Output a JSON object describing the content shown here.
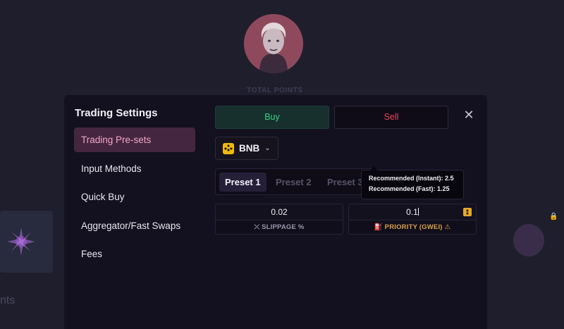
{
  "background": {
    "points_label": "TOTAL POINTS",
    "left_text": "nts"
  },
  "modal": {
    "title": "Trading Settings",
    "nav": [
      {
        "label": "Trading Pre-sets",
        "active": true
      },
      {
        "label": "Input Methods",
        "active": false
      },
      {
        "label": "Quick Buy",
        "active": false
      },
      {
        "label": "Aggregator/Fast Swaps",
        "active": false
      },
      {
        "label": "Fees",
        "active": false
      }
    ],
    "tabs": {
      "buy": "Buy",
      "sell": "Sell"
    },
    "chain": {
      "label": "BNB",
      "icon": "bnb-icon"
    },
    "presets": [
      {
        "label": "Preset 1",
        "active": true
      },
      {
        "label": "Preset 2",
        "active": false
      },
      {
        "label": "Preset 3",
        "active": false
      }
    ],
    "tooltip": {
      "line1": "Recommended (Instant): 2.5",
      "line2": "Recommended (Fast): 1.25"
    },
    "slippage": {
      "value": "0.02",
      "label": "SLIPPAGE %"
    },
    "priority": {
      "value": "0.1",
      "label": "PRIORITY (GWEI)"
    }
  },
  "colors": {
    "accent_pink": "#f2a7c8",
    "buy_green": "#37d089",
    "sell_red": "#e8485d",
    "priority_gold": "#d6a24a"
  }
}
